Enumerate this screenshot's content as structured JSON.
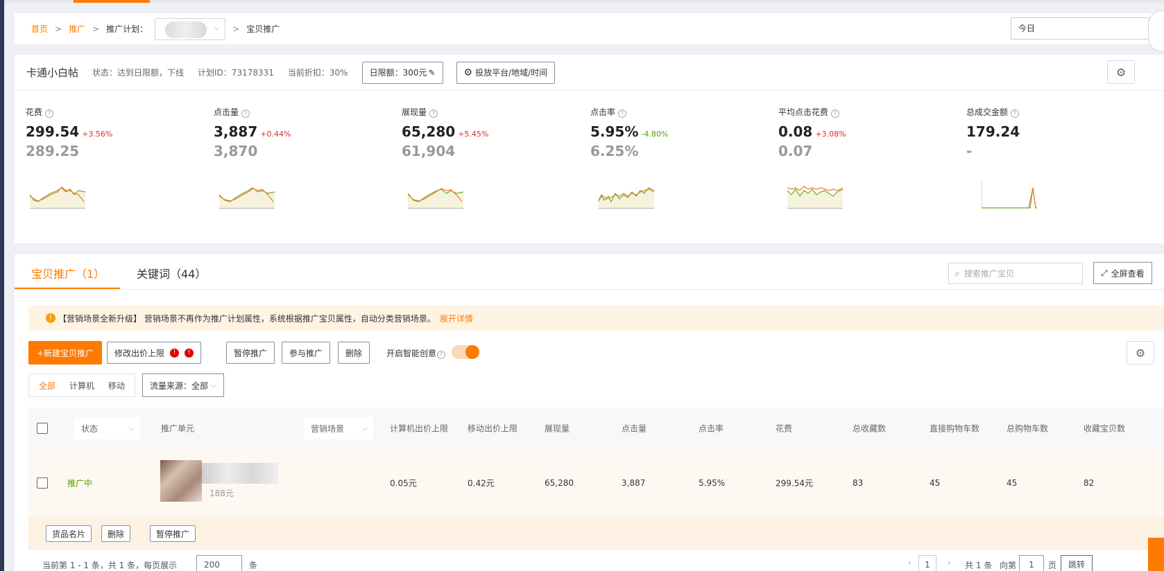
{
  "breadcrumb": {
    "home": "首页",
    "promo": "推广",
    "plan_label": "推广计划：",
    "current": "宝贝推广"
  },
  "date_range": "今日",
  "plan": {
    "name": "卡通小白帖",
    "status": "状态：达到日限额，下线",
    "plan_id": "计划ID：73178331",
    "discount": "当前折扣：30%",
    "daily_budget": "日限额：300元",
    "delivery_btn": "投放平台/地域/时间"
  },
  "metrics": [
    {
      "label": "花费",
      "value": "299.54",
      "change": "+3.56%",
      "dir": "up",
      "prev": "289.25"
    },
    {
      "label": "点击量",
      "value": "3,887",
      "change": "+0.44%",
      "dir": "up",
      "prev": "3,870"
    },
    {
      "label": "展现量",
      "value": "65,280",
      "change": "+5.45%",
      "dir": "up",
      "prev": "61,904"
    },
    {
      "label": "点击率",
      "value": "5.95%",
      "change": "-4.80%",
      "dir": "down",
      "prev": "6.25%"
    },
    {
      "label": "平均点击花费",
      "value": "0.08",
      "change": "+3.08%",
      "dir": "up",
      "prev": "0.07"
    },
    {
      "label": "总成交金额",
      "value": "179.24",
      "change": "",
      "dir": "",
      "prev": "-"
    }
  ],
  "tabs": [
    {
      "label": "宝贝推广（1）"
    },
    {
      "label": "关键词（44）"
    }
  ],
  "search": {
    "placeholder": "搜索推广宝贝"
  },
  "fullscreen": "全屏查看",
  "notice": {
    "text": "【营销场景全新升级】 营销场景不再作为推广计划属性，系统根据推广宝贝属性，自动分类营销场景。",
    "link": "展开详情"
  },
  "toolbar": {
    "new_btn": "+新建宝贝推广",
    "modify_btn": "修改出价上限",
    "pause_btn": "暂停推广",
    "join_btn": "参与推广",
    "delete_btn": "删除",
    "smart_label": "开启智能创意"
  },
  "filters": {
    "device": [
      "全部",
      "计算机",
      "移动"
    ],
    "source": "流量来源：全部"
  },
  "table": {
    "headers": {
      "status": "状态",
      "unit": "推广单元",
      "scene": "营销场景",
      "pc_bid": "计算机出价上限",
      "mobile_bid": "移动出价上限",
      "impressions": "展现量",
      "clicks": "点击量",
      "ctr": "点击率",
      "cost": "花费",
      "favorites": "总收藏数",
      "direct_cart": "直接购物车数",
      "total_cart": "总购物车数",
      "fav_items": "收藏宝贝数"
    },
    "rows": [
      {
        "status": "推广中",
        "price": "188元",
        "pc_bid": "0.05元",
        "mobile_bid": "0.42元",
        "impressions": "65,280",
        "clicks": "3,887",
        "ctr": "5.95%",
        "cost": "299.54元",
        "favorites": "83",
        "direct_cart": "45",
        "total_cart": "45",
        "fav_items": "82"
      }
    ],
    "row_actions": [
      "货品名片",
      "删除",
      "暂停推广"
    ]
  },
  "pager": {
    "left": "当前第 1 - 1 条，共 1 条，每页展示",
    "per_page": "200",
    "unit": "条",
    "page": "1",
    "total": "共 1 条",
    "goto": "向第",
    "goto_page": "1",
    "page_unit": "页",
    "jump": "跳转"
  },
  "colors": {
    "accent": "#ff7a00",
    "up": "#e02a2a",
    "down": "#52a000"
  }
}
